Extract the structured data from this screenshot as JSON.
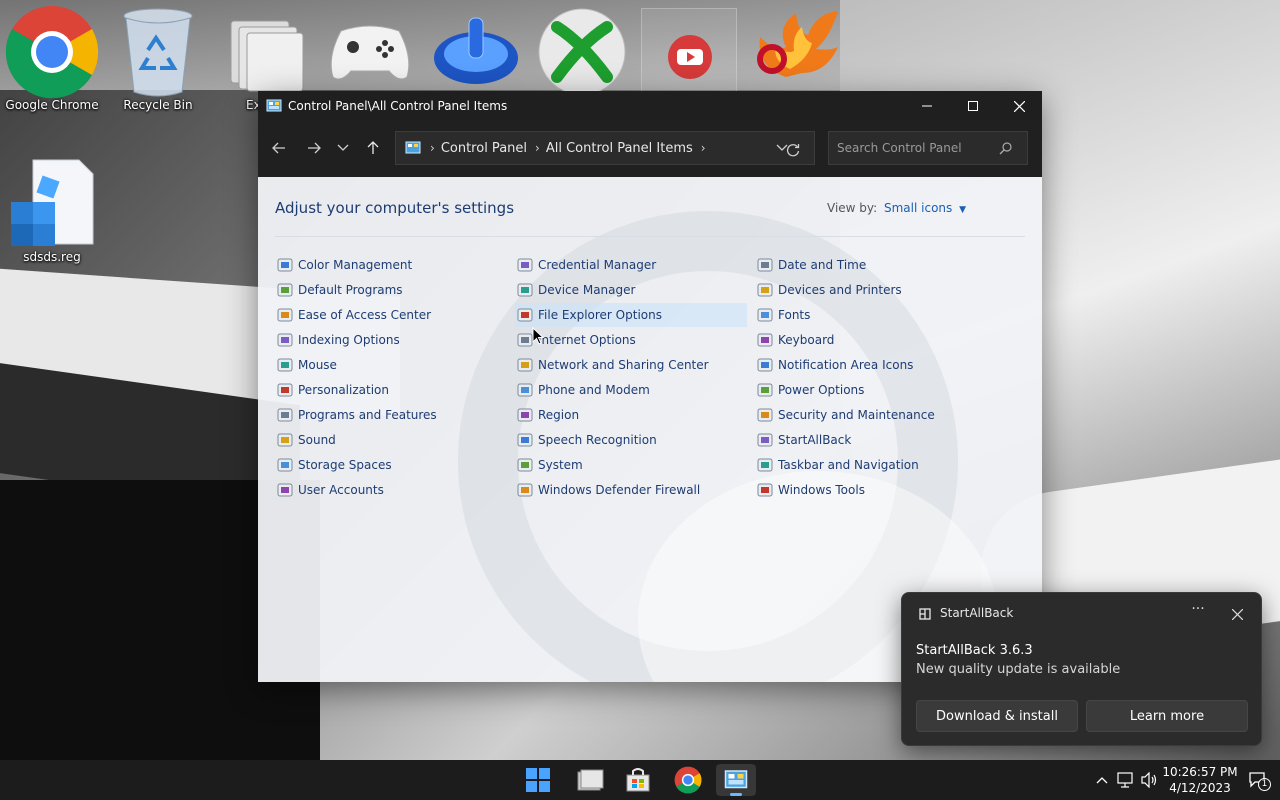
{
  "desktop": {
    "icons": [
      {
        "label": "Google Chrome",
        "icon": "chrome-icon"
      },
      {
        "label": "Recycle Bin",
        "icon": "recycle-bin-icon"
      },
      {
        "label": "Exce",
        "icon": "folder-stack-icon"
      },
      {
        "label": "",
        "icon": "xbox-controller-icon"
      },
      {
        "label": "",
        "icon": "blue-power-icon"
      },
      {
        "label": "",
        "icon": "xbox-icon"
      },
      {
        "label": "",
        "icon": "youtube-icon"
      },
      {
        "label": "",
        "icon": "phoenix-icon"
      },
      {
        "label": "sdsds.reg",
        "icon": "registry-file-icon"
      }
    ]
  },
  "window": {
    "title": "Control Panel\\All Control Panel Items",
    "breadcrumb": [
      "Control Panel",
      "All Control Panel Items"
    ],
    "search_placeholder": "Search Control Panel",
    "heading": "Adjust your computer's settings",
    "view_by_label": "View by:",
    "view_by_value": "Small icons",
    "columns": [
      [
        {
          "label": "Color Management",
          "icon": "color-management-icon"
        },
        {
          "label": "Default Programs",
          "icon": "default-programs-icon"
        },
        {
          "label": "Ease of Access Center",
          "icon": "ease-of-access-icon"
        },
        {
          "label": "Indexing Options",
          "icon": "indexing-options-icon"
        },
        {
          "label": "Mouse",
          "icon": "mouse-icon"
        },
        {
          "label": "Personalization",
          "icon": "personalization-icon"
        },
        {
          "label": "Programs and Features",
          "icon": "programs-features-icon"
        },
        {
          "label": "Sound",
          "icon": "sound-icon"
        },
        {
          "label": "Storage Spaces",
          "icon": "storage-spaces-icon"
        },
        {
          "label": "User Accounts",
          "icon": "user-accounts-icon"
        }
      ],
      [
        {
          "label": "Credential Manager",
          "icon": "credential-manager-icon"
        },
        {
          "label": "Device Manager",
          "icon": "device-manager-icon"
        },
        {
          "label": "File Explorer Options",
          "icon": "file-explorer-options-icon"
        },
        {
          "label": "Internet Options",
          "icon": "internet-options-icon"
        },
        {
          "label": "Network and Sharing Center",
          "icon": "network-sharing-icon"
        },
        {
          "label": "Phone and Modem",
          "icon": "phone-modem-icon"
        },
        {
          "label": "Region",
          "icon": "region-icon"
        },
        {
          "label": "Speech Recognition",
          "icon": "speech-recognition-icon"
        },
        {
          "label": "System",
          "icon": "system-icon"
        },
        {
          "label": "Windows Defender Firewall",
          "icon": "firewall-icon"
        }
      ],
      [
        {
          "label": "Date and Time",
          "icon": "date-time-icon"
        },
        {
          "label": "Devices and Printers",
          "icon": "devices-printers-icon"
        },
        {
          "label": "Fonts",
          "icon": "fonts-icon"
        },
        {
          "label": "Keyboard",
          "icon": "keyboard-icon"
        },
        {
          "label": "Notification Area Icons",
          "icon": "notification-area-icon"
        },
        {
          "label": "Power Options",
          "icon": "power-options-icon"
        },
        {
          "label": "Security and Maintenance",
          "icon": "security-maintenance-icon"
        },
        {
          "label": "StartAllBack",
          "icon": "startallback-icon"
        },
        {
          "label": "Taskbar and Navigation",
          "icon": "taskbar-navigation-icon"
        },
        {
          "label": "Windows Tools",
          "icon": "windows-tools-icon"
        }
      ]
    ]
  },
  "toast": {
    "app_name": "StartAllBack",
    "title": "StartAllBack 3.6.3",
    "body": "New quality update is available",
    "primary_button": "Download & install",
    "secondary_button": "Learn more"
  },
  "taskbar": {
    "time": "10:26:57 PM",
    "date": "4/12/2023",
    "notification_count": "1"
  },
  "colors": {
    "accent_link": "#1e3c74",
    "view_by_link": "#1a5fb4",
    "titlebar": "#1f1f1f",
    "hover_highlight": "#cce4f7"
  }
}
